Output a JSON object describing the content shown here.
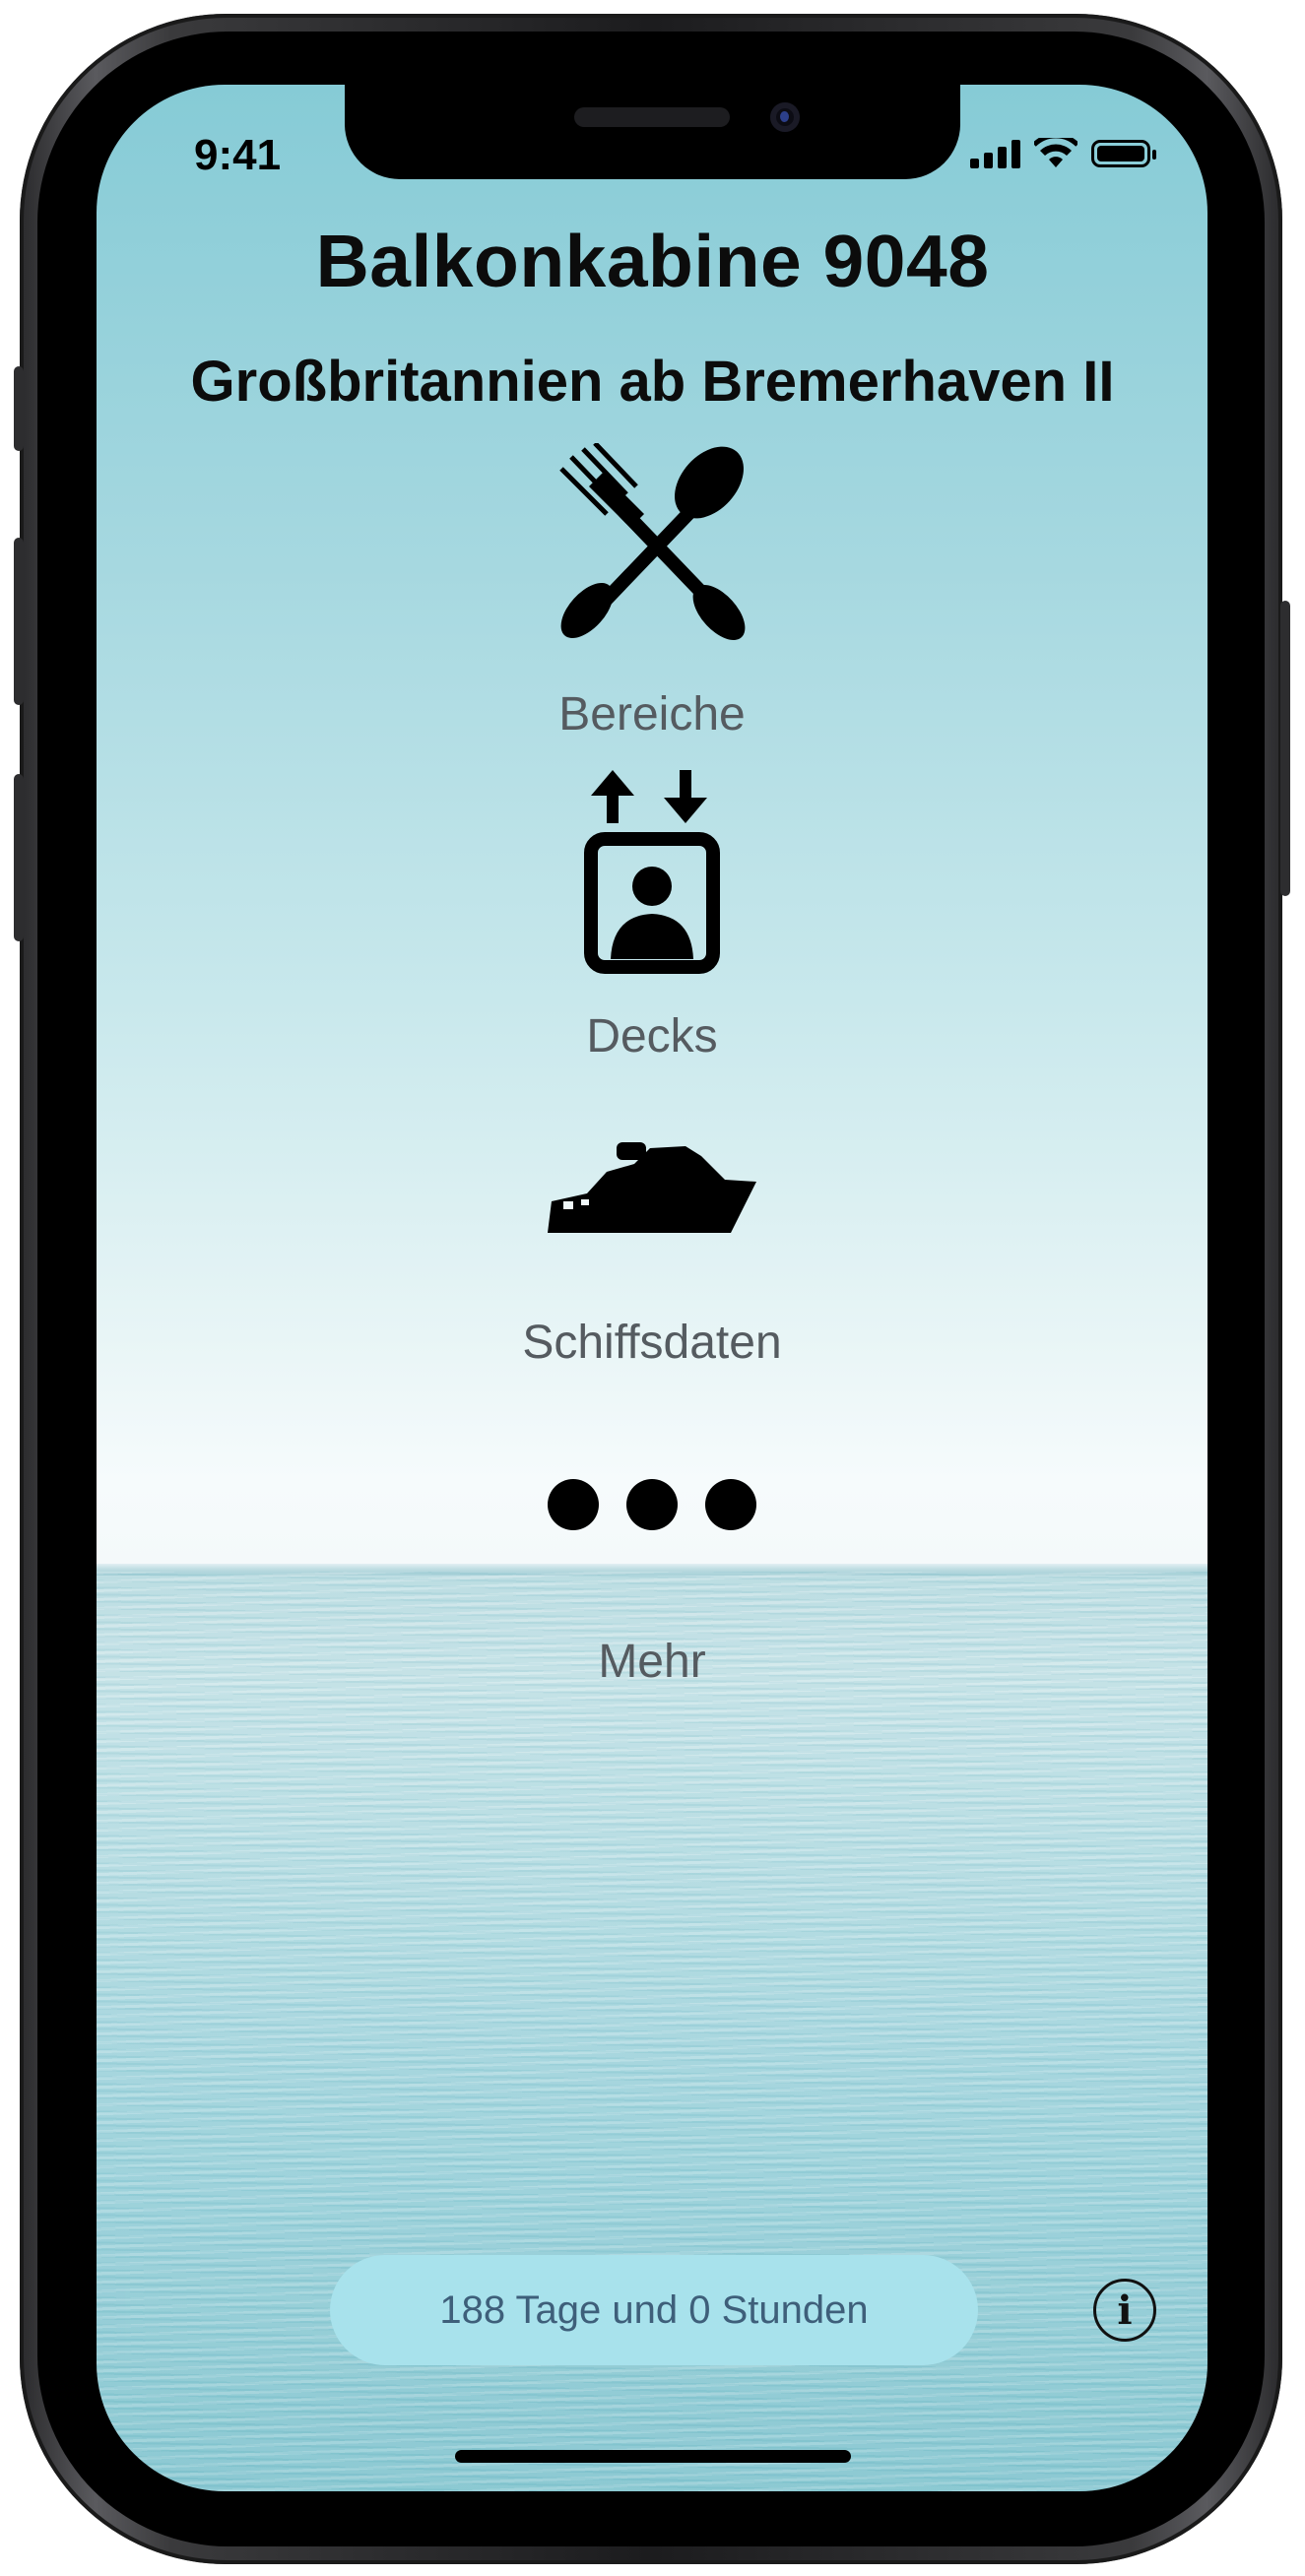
{
  "status_bar": {
    "time": "9:41"
  },
  "header": {
    "title": "Balkonkabine 9048",
    "subtitle": "Großbritannien ab Bremerhaven II"
  },
  "menu": [
    {
      "label": "Bereiche",
      "icon": "cutlery-icon"
    },
    {
      "label": "Decks",
      "icon": "elevator-icon"
    },
    {
      "label": "Schiffsdaten",
      "icon": "ship-icon"
    },
    {
      "label": "Mehr",
      "icon": "more-icon"
    }
  ],
  "footer": {
    "countdown": "188 Tage und 0 Stunden",
    "info_icon": "info-icon",
    "countdown_bg": "#a8e2ec"
  }
}
